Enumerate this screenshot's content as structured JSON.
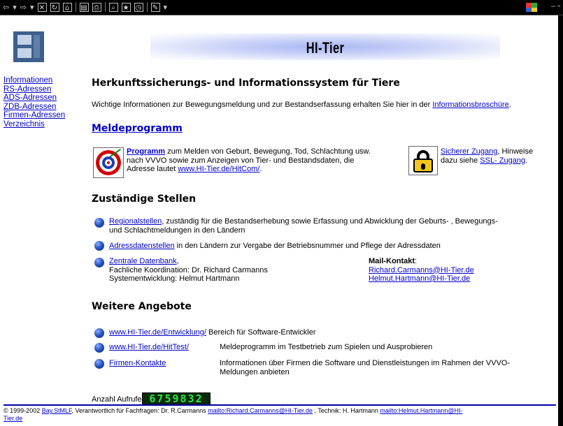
{
  "toolbar": {
    "icons": [
      "back-icon",
      "forward-icon",
      "stop-icon",
      "refresh-icon",
      "home-icon",
      "preview-icon",
      "print-icon",
      "search-icon",
      "favorites-icon",
      "history-icon",
      "edit-icon"
    ]
  },
  "banner": {
    "title": "HI-Tier"
  },
  "sidenav": {
    "items": [
      "Informationen",
      "RS-Adressen",
      "ADS-Adressen",
      "ZDB-Adressen",
      "Firmen-Adressen",
      "Verzeichnis"
    ]
  },
  "main": {
    "headline": "Herkunftssicherungs- und Informationssystem für Tiere",
    "intro_text": "Wichtige Informationen zur Bewegungsmeldung und zur Bestandserfassung erhalten Sie hier in der ",
    "intro_link": "Informationsbroschüre",
    "intro_end": ".",
    "melde_heading": "Meldeprogramm",
    "programm_link": "Programm",
    "programm_text1": " zum Melden von Geburt, Bewegung, Tod, Schlachtung usw.",
    "programm_text2": "nach VVVO sowie zum Anzeigen von Tier- und Bestandsdaten, die",
    "programm_text3": "Adresse lautet ",
    "programm_url": "www.HI-Tier.de/HitCom/",
    "programm_end": ".",
    "secure_link": "Sicherer Zugang",
    "secure_text1": ", Hinweise",
    "secure_text2": "dazu siehe ",
    "ssl_link": "SSL- Zugang",
    "ssl_end": ".",
    "zust_heading": "Zuständige Stellen",
    "regional_link": "Regionalstellen",
    "regional_text1": ", zuständig für die Bestandserhebung sowie Erfassung und Abwicklung der Geburts- , Bewegungs-",
    "regional_text2": "und Schlachtmeldungen in den Ländern",
    "adress_link": "Adressdatenstellen",
    "adress_text": " in den Ländern zur Vergabe der Betriebsnummer und Pflege der Adressdaten",
    "zdb_link": "Zentrale Datenbank",
    "zdb_end": ",",
    "zdb_line2": "Fachliche Koordination: Dr. Richard Carmanns",
    "zdb_line3": "Systementwicklung: Helmut Hartmann",
    "mail_label": "Mail-Kontakt",
    "mail_colon": ":",
    "mail1": "Richard.Carmanns@HI-Tier.de",
    "mail2": "Helmut.Hartmann@HI-Tier.de",
    "weitere_heading": "Weitere Angebote",
    "offers": [
      {
        "link": "www.HI-Tier.de/Entwicklung/",
        "desc": "Bereich für Software-Entwickler"
      },
      {
        "link": "www.HI-Tier.de/HitTest/",
        "desc": "Meldeprogramm im Testbetrieb zum Spielen und Ausprobieren"
      },
      {
        "link": "Firmen-Kontakte",
        "desc": "Informationen über Firmen die Software und Dienstleistungen im Rahmen der VVVO-",
        "desc2": "Meldungen anbieten"
      }
    ],
    "counter_label": "Anzahl Aufrufe:",
    "counter_value": "6759832"
  },
  "footer": {
    "copyright": "© 1999-2002 ",
    "org_link": "Bay.StMLF",
    "text1": ", Verantwortlich für Fachfragen: Dr. R.Carmanns ",
    "mail_carmanns": "mailto:Richard.Carmanns@HI-Tier.de",
    "text2": " , Technik: H. Hartmann ",
    "mail_hartmann": "mailto:Helmut.Hartmann@HI-",
    "mail_hartmann2": "Tier.de"
  },
  "colors": {
    "link": "#0000cc",
    "footer_rule": "#0000aa",
    "banner_glow": "#a8b6f3",
    "counter_digits": "#29e84a"
  }
}
